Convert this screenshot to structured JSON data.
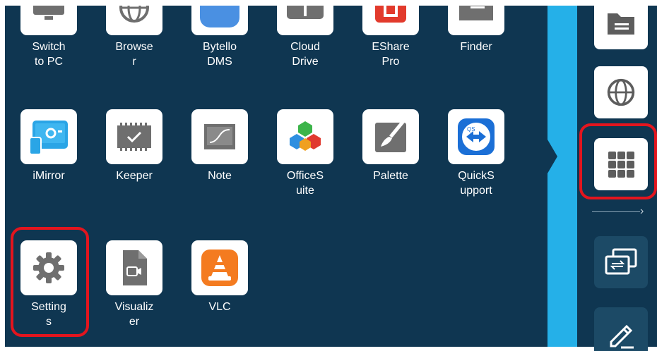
{
  "launcher": {
    "apps": [
      {
        "name": "switch-to-pc",
        "label": "Switch\nto PC",
        "icon": "monitor-pc-icon"
      },
      {
        "name": "browser",
        "label": "Browse\nr",
        "icon": "globe-icon"
      },
      {
        "name": "bytello-dms",
        "label": "Bytello\nDMS",
        "icon": "bytello-dms-icon"
      },
      {
        "name": "cloud-drive",
        "label": "Cloud\nDrive",
        "icon": "cloud-drive-icon"
      },
      {
        "name": "eshare-pro",
        "label": "EShare\nPro",
        "icon": "eshare-icon"
      },
      {
        "name": "finder",
        "label": "Finder",
        "icon": "folder-icon"
      },
      {
        "name": "imirror",
        "label": "iMirror",
        "icon": "imirror-icon"
      },
      {
        "name": "keeper",
        "label": "Keeper",
        "icon": "keeper-chip-icon"
      },
      {
        "name": "note",
        "label": "Note",
        "icon": "note-board-icon"
      },
      {
        "name": "officesuite",
        "label": "OfficeS\nuite",
        "icon": "officesuite-icon"
      },
      {
        "name": "palette",
        "label": "Palette",
        "icon": "palette-brush-icon"
      },
      {
        "name": "quicksupport",
        "label": "QuickS\nupport",
        "icon": "quicksupport-icon"
      },
      {
        "name": "settings",
        "label": "Setting\ns",
        "icon": "gear-icon"
      },
      {
        "name": "visualizer",
        "label": "Visualiz\ner",
        "icon": "visualizer-icon"
      },
      {
        "name": "vlc",
        "label": "VLC",
        "icon": "vlc-cone-icon"
      }
    ]
  },
  "sidebar": {
    "buttons": [
      {
        "name": "sidebar-finder",
        "icon": "folder-icon"
      },
      {
        "name": "sidebar-browser",
        "icon": "globe-icon"
      },
      {
        "name": "sidebar-apps",
        "icon": "grid-icon"
      },
      {
        "name": "sidebar-screen-switch",
        "icon": "screen-switch-icon"
      },
      {
        "name": "sidebar-annotate",
        "icon": "pencil-icon"
      }
    ],
    "expand_icon": "chevron-right-icon"
  },
  "highlights": [
    "settings-app",
    "sidebar-apps"
  ],
  "colors": {
    "background": "#0f3651",
    "accent_strip": "#25b0e8",
    "highlight": "#e3151e",
    "tile": "#ffffff"
  }
}
